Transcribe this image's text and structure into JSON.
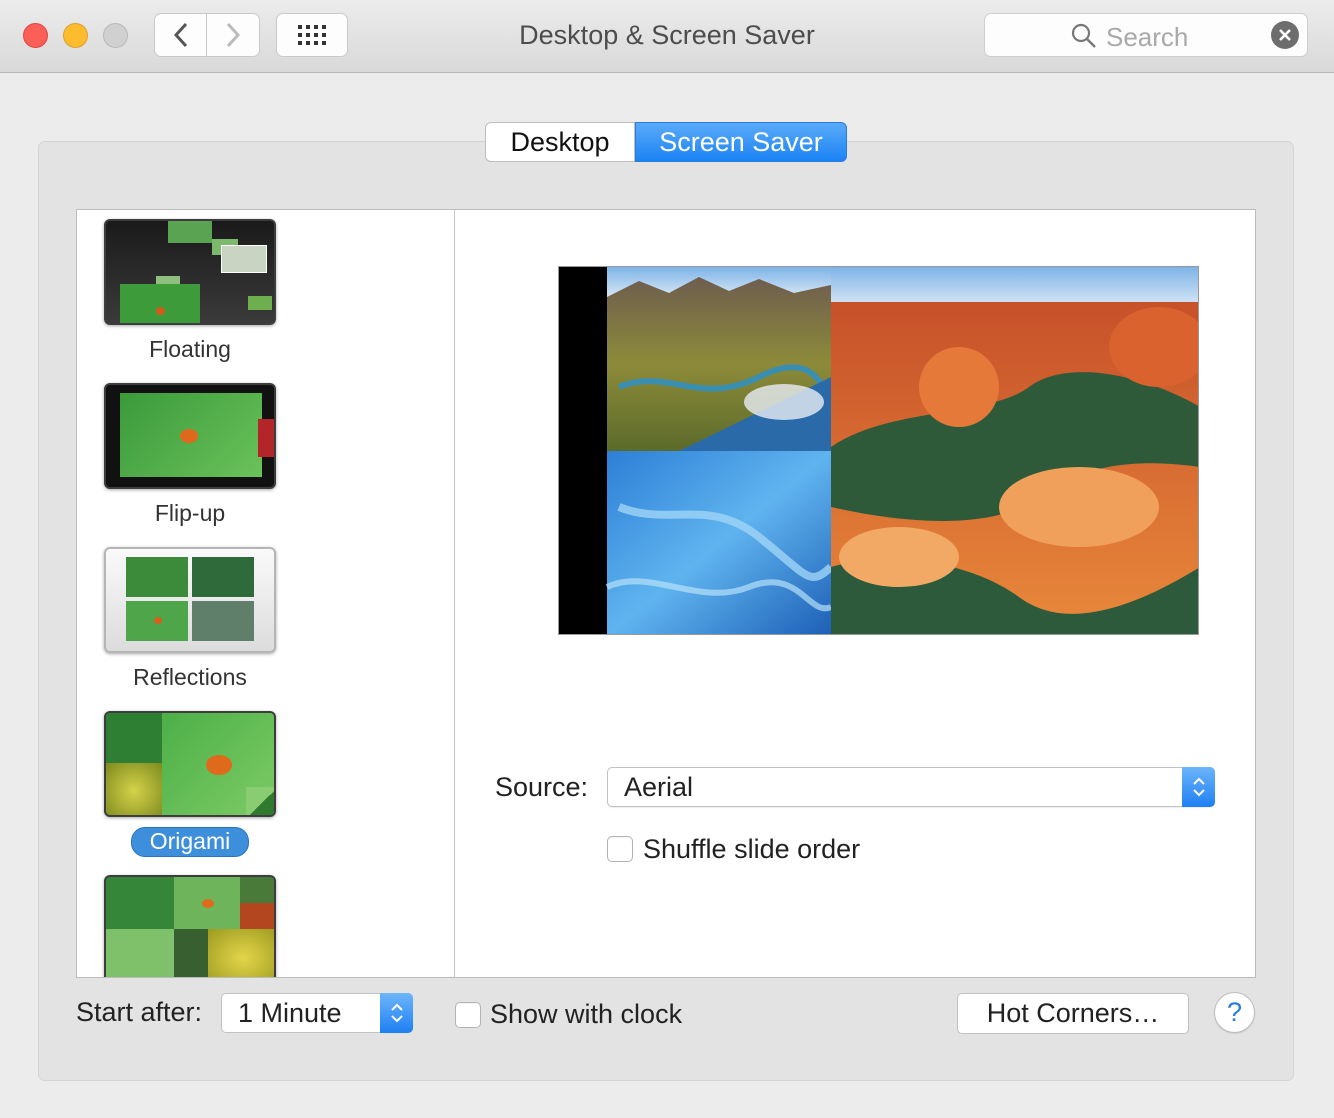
{
  "window": {
    "title": "Desktop & Screen Saver"
  },
  "toolbar": {
    "back_icon": "chevron-left-icon",
    "forward_icon": "chevron-right-icon",
    "grid_icon": "grid-icon"
  },
  "search": {
    "placeholder": "Search"
  },
  "tabs": [
    {
      "label": "Desktop",
      "selected": false
    },
    {
      "label": "Screen Saver",
      "selected": true
    }
  ],
  "screensavers": [
    {
      "label": "Floating",
      "selected": false
    },
    {
      "label": "Flip-up",
      "selected": false
    },
    {
      "label": "Reflections",
      "selected": false
    },
    {
      "label": "Origami",
      "selected": true
    },
    {
      "label": "",
      "selected": false
    }
  ],
  "options": {
    "source_label": "Source:",
    "source_value": "Aerial",
    "shuffle_label": "Shuffle slide order",
    "shuffle_checked": false
  },
  "bottom": {
    "start_after_label": "Start after:",
    "start_after_value": "1 Minute",
    "show_clock_label": "Show with clock",
    "show_clock_checked": false,
    "hot_corners_label": "Hot Corners…",
    "help_label": "?"
  },
  "colors": {
    "accent": "#1c83f5",
    "selection": "#3d8fdc",
    "close": "#fc5f57",
    "minimize": "#fdbc2e",
    "zoom": "#d0d0d0"
  }
}
